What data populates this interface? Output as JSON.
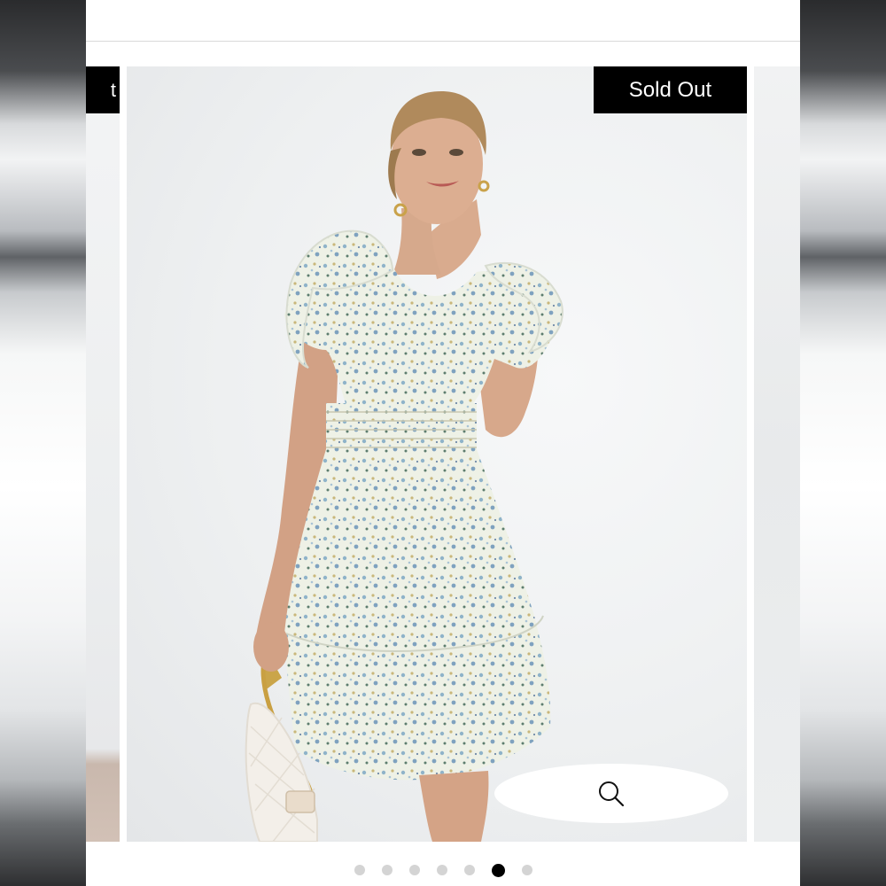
{
  "product": {
    "status_badge": "Sold Out",
    "prev_badge_fragment": "t"
  },
  "gallery": {
    "slide_count": 7,
    "active_index": 5,
    "zoom_icon": "search-icon"
  },
  "colors": {
    "badge_bg": "#000000",
    "badge_text": "#ffffff",
    "dot_active": "#000000",
    "dot_inactive": "#d4d4d4"
  }
}
